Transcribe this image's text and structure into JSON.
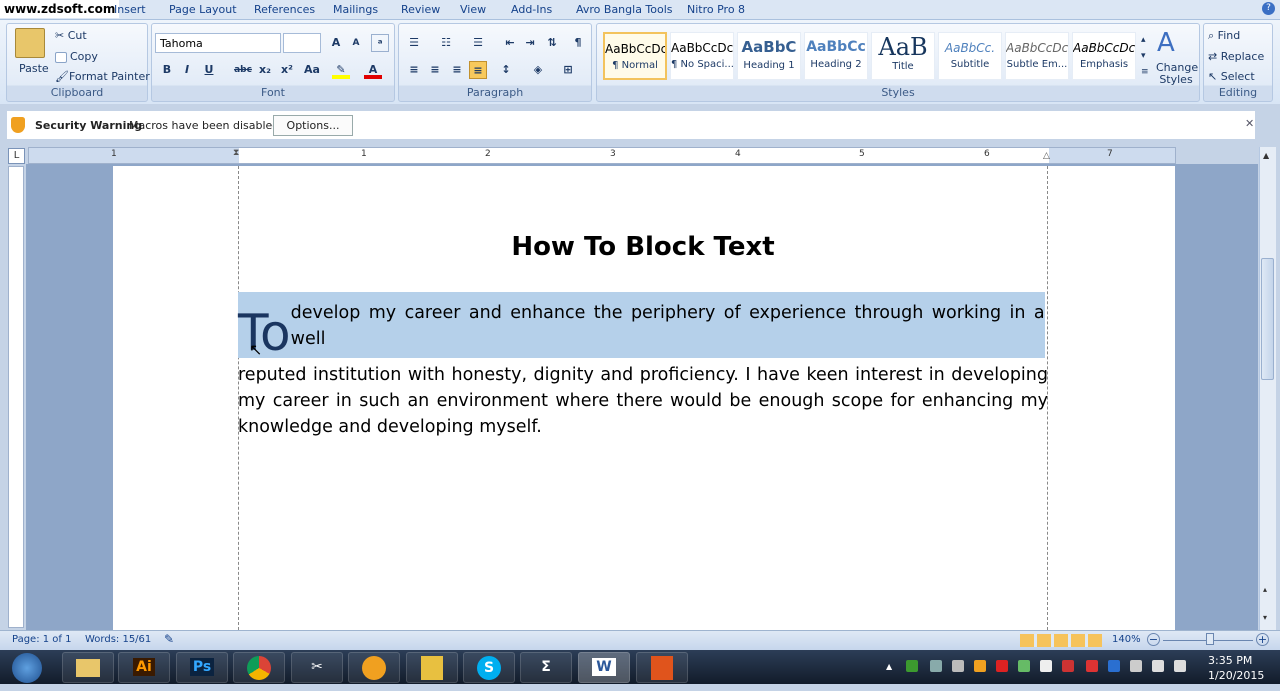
{
  "tabs": {
    "brand": "www.zdsoft.com",
    "items": [
      "Insert",
      "Page Layout",
      "References",
      "Mailings",
      "Review",
      "View",
      "Add-Ins",
      "Avro Bangla Tools",
      "Nitro Pro 8"
    ]
  },
  "clipboard": {
    "label": "Clipboard",
    "paste": "Paste",
    "cut": "Cut",
    "copy": "Copy",
    "format_painter": "Format Painter"
  },
  "font": {
    "label": "Font",
    "name": "Tahoma",
    "size": "",
    "bold": "B",
    "italic": "I",
    "underline": "U",
    "strike": "abc",
    "sub": "x₂",
    "sup": "x²",
    "case": "Aa",
    "grow": "A",
    "shrink": "A",
    "color_text": "A",
    "font_color": "#e00000",
    "highlight_color": "#ffff00"
  },
  "paragraph": {
    "label": "Paragraph",
    "pilcrow": "¶"
  },
  "styles": {
    "label": "Styles",
    "items": [
      {
        "preview": "AaBbCcDc",
        "name": "¶ Normal"
      },
      {
        "preview": "AaBbCcDc",
        "name": "¶ No Spaci..."
      },
      {
        "preview": "AaBbC",
        "name": "Heading 1"
      },
      {
        "preview": "AaBbCc",
        "name": "Heading 2"
      },
      {
        "preview": "AaB",
        "name": "Title"
      },
      {
        "preview": "AaBbCc.",
        "name": "Subtitle"
      },
      {
        "preview": "AaBbCcDc",
        "name": "Subtle Em..."
      },
      {
        "preview": "AaBbCcDc",
        "name": "Emphasis"
      }
    ],
    "change": "Change Styles"
  },
  "editing": {
    "label": "Editing",
    "find": "Find",
    "replace": "Replace",
    "select": "Select"
  },
  "security": {
    "title": "Security Warning",
    "message": "Macros have been disabled.",
    "options": "Options..."
  },
  "ruler": {
    "numbers": [
      "1",
      "1",
      "2",
      "3",
      "4",
      "5",
      "6",
      "7"
    ]
  },
  "document": {
    "title": "How To Block Text",
    "dropcap": "To",
    "para_first": " develop my career and enhance the periphery of experience through working in a well",
    "para_rest": "reputed institution with honesty, dignity and proficiency. I have keen interest in developing my career in such an environment where there would be enough scope for enhancing my knowledge and developing myself."
  },
  "status": {
    "page": "Page: 1 of 1",
    "words": "Words: 15/61",
    "zoom": "140%"
  },
  "taskbar": {
    "apps": [
      "Ai",
      "Ps",
      "W"
    ],
    "time": "3:35 PM",
    "date": "1/20/2015"
  }
}
